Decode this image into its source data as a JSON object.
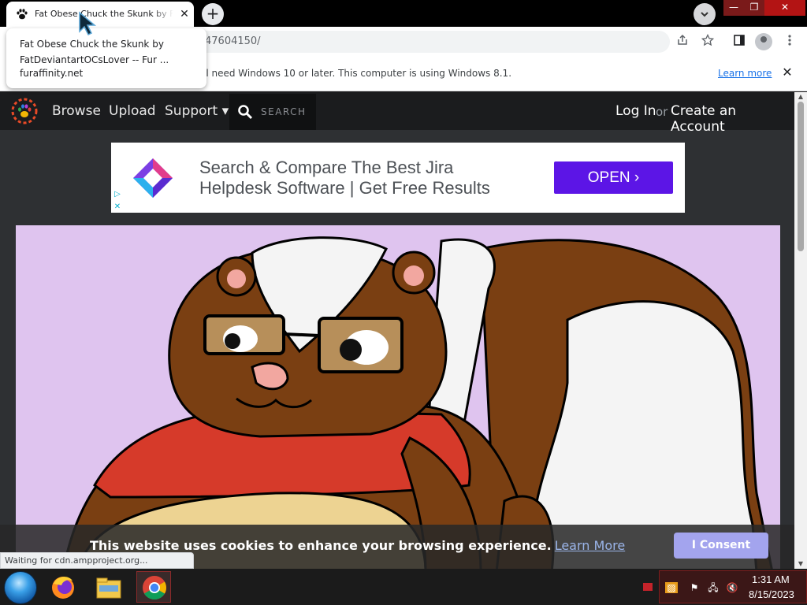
{
  "browser": {
    "tab_title": "Fat Obese Chuck the Skunk by FatDeviantartOCsLover -- Fur Affinity",
    "tab_close": "✕",
    "new_tab": "+",
    "tab_search": "⌄",
    "url_visible": "47604150/",
    "hover_card": {
      "title": "Fat Obese Chuck the Skunk by FatDeviantartOCsLover -- Fur ...",
      "domain": "furaffinity.net"
    },
    "infobar": {
      "text": "ll need Windows 10 or later. This computer is using Windows 8.1.",
      "link": "Learn more",
      "close": "✕"
    },
    "status_text": "Waiting for cdn.ampproject.org...",
    "icons": [
      "share-icon",
      "star-icon",
      "side-panel-icon",
      "profile-icon",
      "menu-icon"
    ]
  },
  "site": {
    "nav": {
      "browse": "Browse",
      "upload": "Upload",
      "support": "Support ▾",
      "search_placeholder": "SEARCH",
      "login": "Log In",
      "or": "or",
      "create_account": "Create an Account"
    },
    "ad": {
      "line1": "Search & Compare The Best Jira",
      "line2": "Helpdesk Software | Get Free Results",
      "button": "OPEN ›",
      "button_color": "#5c15e6"
    },
    "cookie": {
      "text": "This website uses cookies to enhance your browsing experience.",
      "link": "Learn More",
      "button": "I Consent"
    },
    "colors": {
      "nav_bg": "#1b1c1e",
      "page_bg": "#2e3033",
      "artwork_bg": "#dfc4ef"
    }
  },
  "taskbar": {
    "time": "1:31 AM",
    "date": "8/15/2023",
    "apps": [
      "firefox-icon",
      "file-explorer-icon",
      "chrome-icon"
    ]
  }
}
